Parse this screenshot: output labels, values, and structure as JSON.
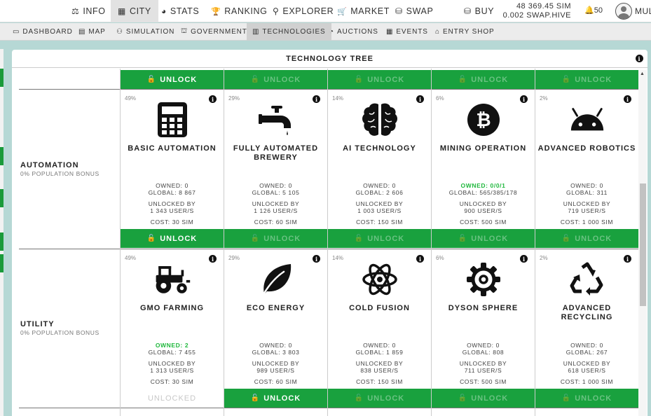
{
  "topnav": {
    "items": [
      {
        "label": "INFO",
        "icon": "scale-icon",
        "glyph": "⚖"
      },
      {
        "label": "CITY",
        "icon": "city-icon",
        "glyph": "▦"
      },
      {
        "label": "STATS",
        "icon": "pie-chart-icon",
        "glyph": "◕"
      },
      {
        "label": "RANKING",
        "icon": "trophy-icon",
        "glyph": "🏆"
      },
      {
        "label": "EXPLORER",
        "icon": "search-icon",
        "glyph": "⚲"
      },
      {
        "label": "MARKET",
        "icon": "cart-icon",
        "glyph": "🛒"
      },
      {
        "label": "SWAP",
        "icon": "coins-icon",
        "glyph": "⛁"
      },
      {
        "label": "BUY",
        "icon": "coin-stack-icon",
        "glyph": "⛁"
      }
    ],
    "balance_sim": "48 369.45 SIM",
    "balance_swap": "0.002 SWAP.HIVE",
    "notifications": "50",
    "username": "MUL"
  },
  "subnav": {
    "items": [
      {
        "label": "DASHBOARD",
        "glyph": "▭"
      },
      {
        "label": "MAP",
        "glyph": "▤"
      },
      {
        "label": "SIMULATION",
        "glyph": "⚇"
      },
      {
        "label": "GOVERNMENT",
        "glyph": "⛫"
      },
      {
        "label": "TECHNOLOGIES",
        "glyph": "▥"
      },
      {
        "label": "AUCTIONS",
        "glyph": "◔"
      },
      {
        "label": "EVENTS",
        "glyph": "▦"
      },
      {
        "label": "ENTRY SHOP",
        "glyph": "⌂"
      }
    ]
  },
  "panel": {
    "title": "TECHNOLOGY TREE",
    "unlock_label": "UNLOCK",
    "unlocked_label": "UNLOCKED",
    "owned_prefix": "OWNED: ",
    "global_prefix": "GLOBAL: ",
    "unlocked_by_label": "UNLOCKED BY",
    "cost_prefix": "COST: "
  },
  "rows": [
    {
      "name": "AUTOMATION",
      "bonus": "0% POPULATION BONUS",
      "techs": [
        {
          "name": "BASIC AUTOMATION",
          "pct": "49%",
          "icon": "calculator-icon",
          "owned": "0",
          "global": "8 867",
          "unlocked_by": "1 343 USER/S",
          "cost": "30 SIM"
        },
        {
          "name": "FULLY AUTOMATED BREWERY",
          "pct": "29%",
          "icon": "faucet-icon",
          "owned": "0",
          "global": "5 105",
          "unlocked_by": "1 126 USER/S",
          "cost": "60 SIM"
        },
        {
          "name": "AI TECHNOLOGY",
          "pct": "14%",
          "icon": "brain-icon",
          "owned": "0",
          "global": "2 606",
          "unlocked_by": "1 003 USER/S",
          "cost": "150 SIM"
        },
        {
          "name": "MINING OPERATION",
          "pct": "6%",
          "icon": "bitcoin-icon",
          "owned": "0/0/1",
          "global": "565/385/178",
          "unlocked_by": "900 USER/S",
          "cost": "500 SIM"
        },
        {
          "name": "ADVANCED ROBOTICS",
          "pct": "2%",
          "icon": "android-icon",
          "owned": "0",
          "global": "311",
          "unlocked_by": "719 USER/S",
          "cost": "1 000 SIM"
        }
      ]
    },
    {
      "name": "UTILITY",
      "bonus": "0% POPULATION BONUS",
      "techs": [
        {
          "name": "GMO FARMING",
          "pct": "49%",
          "icon": "tractor-icon",
          "owned": "2",
          "global": "7 455",
          "unlocked_by": "1 313 USER/S",
          "cost": "30 SIM"
        },
        {
          "name": "ECO ENERGY",
          "pct": "29%",
          "icon": "leaf-icon",
          "owned": "0",
          "global": "3 803",
          "unlocked_by": "989 USER/S",
          "cost": "60 SIM"
        },
        {
          "name": "COLD FUSION",
          "pct": "14%",
          "icon": "atom-icon",
          "owned": "0",
          "global": "1 859",
          "unlocked_by": "838 USER/S",
          "cost": "150 SIM"
        },
        {
          "name": "DYSON SPHERE",
          "pct": "6%",
          "icon": "gear-icon",
          "owned": "0",
          "global": "808",
          "unlocked_by": "711 USER/S",
          "cost": "500 SIM"
        },
        {
          "name": "ADVANCED RECYCLING",
          "pct": "2%",
          "icon": "recycle-icon",
          "owned": "0",
          "global": "267",
          "unlocked_by": "618 USER/S",
          "cost": "1 000 SIM"
        }
      ]
    }
  ],
  "colors": {
    "accent_green": "#19a13e",
    "owned_green": "#1fb83c",
    "background": "#b6d8d5"
  }
}
